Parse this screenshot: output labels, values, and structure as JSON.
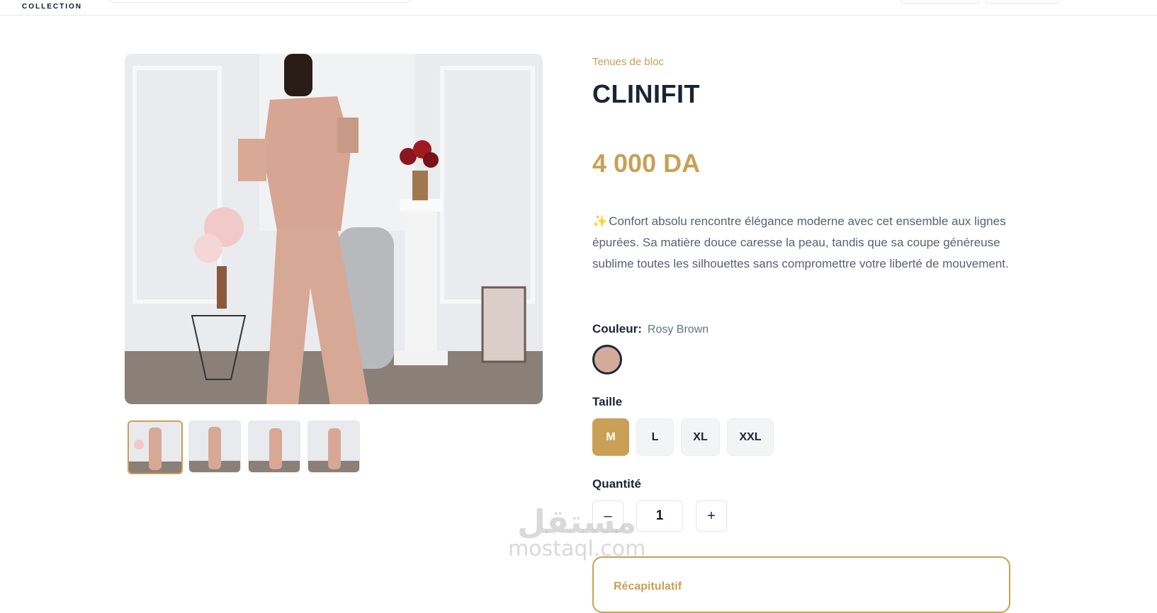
{
  "header": {
    "brand_sub": "COLLECTION"
  },
  "product": {
    "category": "Tenues de bloc",
    "title": "CLINIFIT",
    "price": "4 000 DA",
    "description_icon": "sparkles-icon",
    "description": "Confort absolu rencontre élégance moderne avec cet ensemble aux lignes épurées. Sa matière douce caresse la peau, tandis que sa coupe généreuse sublime toutes les silhouettes sans compromettre votre liberté de mouvement.",
    "color": {
      "label": "Couleur:",
      "value": "Rosy Brown",
      "swatch_hex": "#d4ab9a"
    },
    "size": {
      "label": "Taille",
      "options": [
        "M",
        "L",
        "XL",
        "XXL"
      ],
      "selected": "M"
    },
    "quantity": {
      "label": "Quantité",
      "value": "1",
      "minus": "–",
      "plus": "+"
    },
    "summary": {
      "title": "Récapitulatif"
    }
  },
  "gallery": {
    "thumbnail_count": 4,
    "active_index": 0
  },
  "watermark": {
    "arabic": "مستقل",
    "latin": "mostaql.com"
  },
  "colors": {
    "accent": "#c9a055",
    "title": "#1a2438",
    "text_muted": "#556275"
  }
}
